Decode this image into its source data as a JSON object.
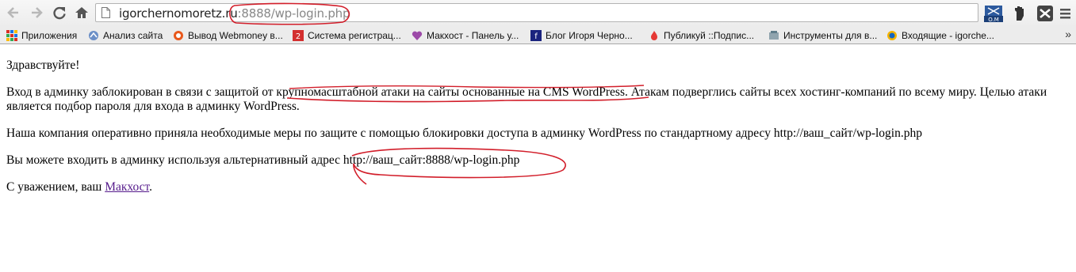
{
  "browser": {
    "address_bar": {
      "host": "igorchernomoretz.ru",
      "path": ":8888/wp-login.php"
    },
    "icons": {
      "back": "back-arrow-icon",
      "forward": "forward-arrow-icon",
      "reload": "reload-icon",
      "home": "home-icon",
      "page": "page-icon"
    },
    "extensions": [
      "ozon-ext-icon",
      "hand-ext-icon",
      "ext-icon",
      "menu-icon"
    ],
    "bookmarks": [
      {
        "label": "Приложения",
        "icon": "apps-grid-icon"
      },
      {
        "label": "Анализ сайта",
        "icon": "analysis-icon"
      },
      {
        "label": "Вывод Webmoney в...",
        "icon": "webmoney-icon"
      },
      {
        "label": "Система регистрац...",
        "icon": "registration-icon"
      },
      {
        "label": "Макхост - Панель у...",
        "icon": "heart-icon"
      },
      {
        "label": "Блог Игоря Черно...",
        "icon": "blog-icon"
      },
      {
        "label": "Публикуй ::Подпис...",
        "icon": "publish-icon"
      },
      {
        "label": "Инструменты для в...",
        "icon": "tools-icon"
      },
      {
        "label": "Входящие - igorche...",
        "icon": "inbox-icon"
      }
    ],
    "bookmarks_more": "»"
  },
  "page": {
    "greeting": "Здравствуйте!",
    "p1": "Вход в админку заблокирован в связи с защитой от крупномасштабной атаки на сайты основанные на CMS WordPress. Атакам подверглись сайты всех хостинг-компаний по всему миру. Целью атаки является подбор пароля для входа в админку WordPress.",
    "p2": "Наша компания оперативно приняла необходимые меры по защите с помощью блокировки доступа в админку WordPress по стандартному адресу http://ваш_сайт/wp-login.php",
    "p3": "Вы можете входить в админку используя альтернативный адрес http://ваш_сайт:8888/wp-login.php",
    "signoff_prefix": "С уважением, ваш ",
    "signoff_link": "Макхост",
    "signoff_suffix": "."
  },
  "colors": {
    "annotation": "#d21e2a",
    "link_visited": "#551a8b"
  }
}
